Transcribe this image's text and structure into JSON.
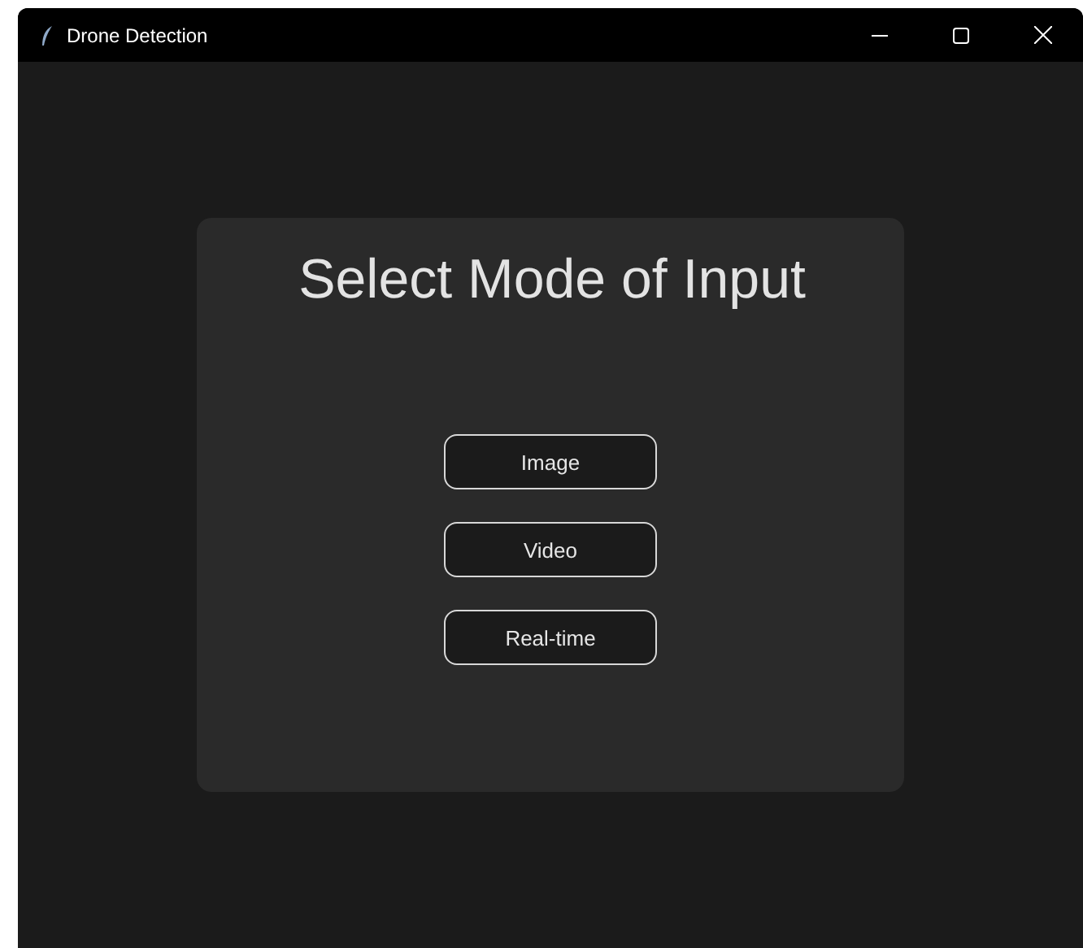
{
  "window": {
    "title": "Drone Detection"
  },
  "heading": "Select Mode of Input",
  "buttons": [
    "Image",
    "Video",
    "Real-time"
  ]
}
